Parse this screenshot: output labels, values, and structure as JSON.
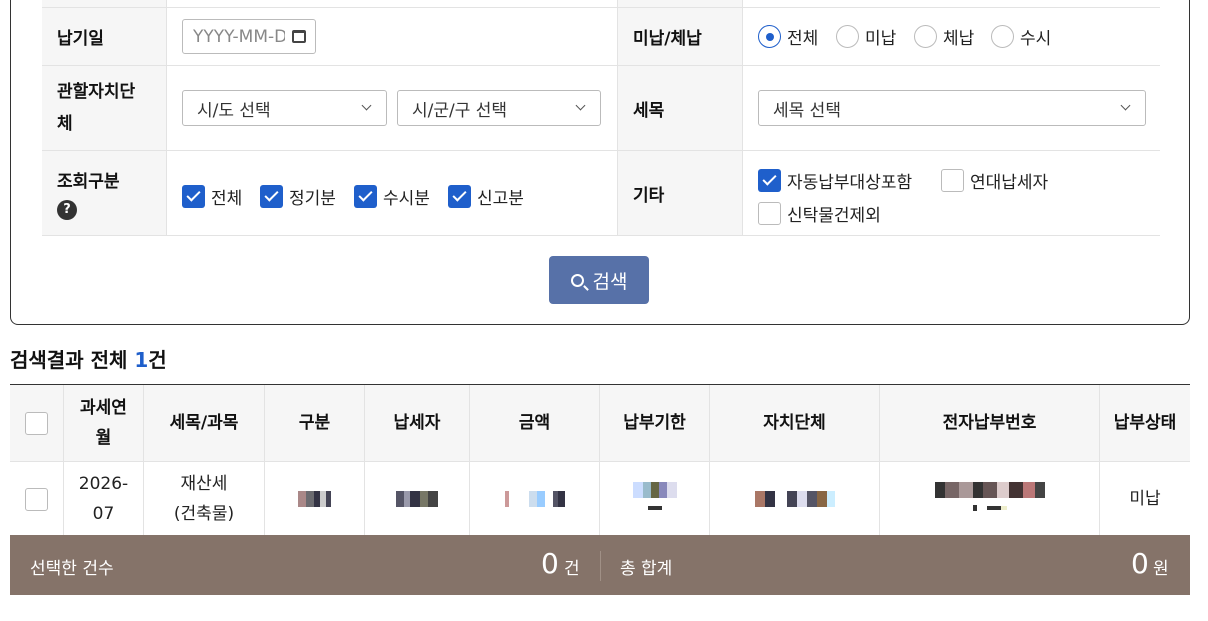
{
  "search": {
    "due_date_label": "납기일",
    "due_date_placeholder": "YYYY-MM-DD",
    "unpaid_label": "미납/체납",
    "unpaid_options": [
      "전체",
      "미납",
      "체납",
      "수시"
    ],
    "unpaid_selected": "전체",
    "region_label": "관할자치단체",
    "sido_select": "시/도 선택",
    "sigungu_select": "시/군/구 선택",
    "tax_label": "세목",
    "tax_select": "세목 선택",
    "query_label": "조회구분",
    "query_help": "?",
    "query_options": [
      "전체",
      "정기분",
      "수시분",
      "신고분"
    ],
    "etc_label": "기타",
    "etc_options": [
      "자동납부대상포함",
      "연대납세자",
      "신탁물건제외"
    ],
    "search_button": "검색"
  },
  "results": {
    "title_prefix": "검색결과 전체 ",
    "count": "1",
    "title_suffix": "건",
    "columns": [
      "과세연월",
      "세목/과목",
      "구분",
      "납세자",
      "금액",
      "납부기한",
      "자치단체",
      "전자납부번호",
      "납부상태"
    ],
    "rows": [
      {
        "period": "2026-07",
        "tax": "재산세 (건축물)",
        "status": "미납"
      }
    ]
  },
  "footer": {
    "selected_label": "선택한 건수",
    "selected_count": "0",
    "selected_unit": "건",
    "total_label": "총 합계",
    "total_amount": "0",
    "total_unit": "원"
  },
  "colors": {
    "accent": "#1f5fcb",
    "button": "#5771a8",
    "footer": "#857369"
  }
}
